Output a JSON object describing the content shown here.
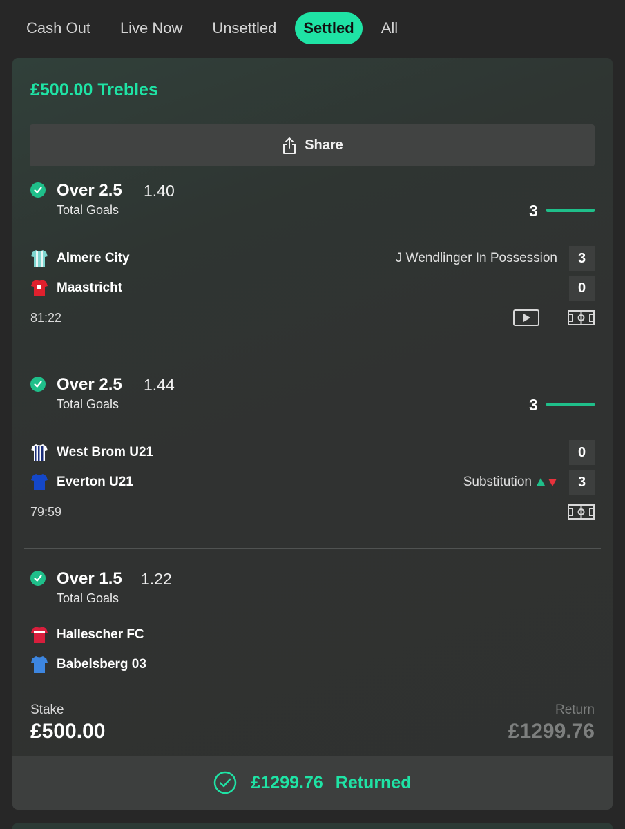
{
  "tabs": [
    {
      "label": "Cash Out",
      "active": false
    },
    {
      "label": "Live Now",
      "active": false
    },
    {
      "label": "Unsettled",
      "active": false
    },
    {
      "label": "Settled",
      "active": true
    },
    {
      "label": "All",
      "active": false
    }
  ],
  "bet": {
    "title": "£500.00 Trebles",
    "share_label": "Share"
  },
  "selections": [
    {
      "name": "Over 2.5",
      "odds": "1.40",
      "market": "Total Goals",
      "goal_count": "3",
      "home": {
        "name": "Almere City",
        "score": "3",
        "kit": "stripes-teal"
      },
      "away": {
        "name": "Maastricht",
        "score": "0",
        "kit": "red"
      },
      "event_text": "J Wendlinger In Possession",
      "time": "81:22"
    },
    {
      "name": "Over 2.5",
      "odds": "1.44",
      "market": "Total Goals",
      "goal_count": "3",
      "home": {
        "name": "West Brom U21",
        "score": "0",
        "kit": "stripes-navy"
      },
      "away": {
        "name": "Everton U21",
        "score": "3",
        "kit": "blue"
      },
      "event_text": "Substitution",
      "time": "79:59"
    },
    {
      "name": "Over 1.5",
      "odds": "1.22",
      "market": "Total Goals",
      "home": {
        "name": "Hallescher FC",
        "kit": "red"
      },
      "away": {
        "name": "Babelsberg 03",
        "kit": "light-blue"
      }
    }
  ],
  "stake": {
    "label": "Stake",
    "value": "£500.00"
  },
  "return": {
    "label": "Return",
    "value": "£1299.76"
  },
  "returned": {
    "amount": "£1299.76",
    "word": "Returned"
  },
  "colors": {
    "accent": "#1fe3a5",
    "check": "#1fbf8a",
    "card_bg": "#303231",
    "page_bg": "#272727"
  },
  "icons": [
    "share-icon",
    "check-icon",
    "play-icon",
    "pitch-icon",
    "arrow-up-icon",
    "arrow-down-icon",
    "kit-icon"
  ]
}
